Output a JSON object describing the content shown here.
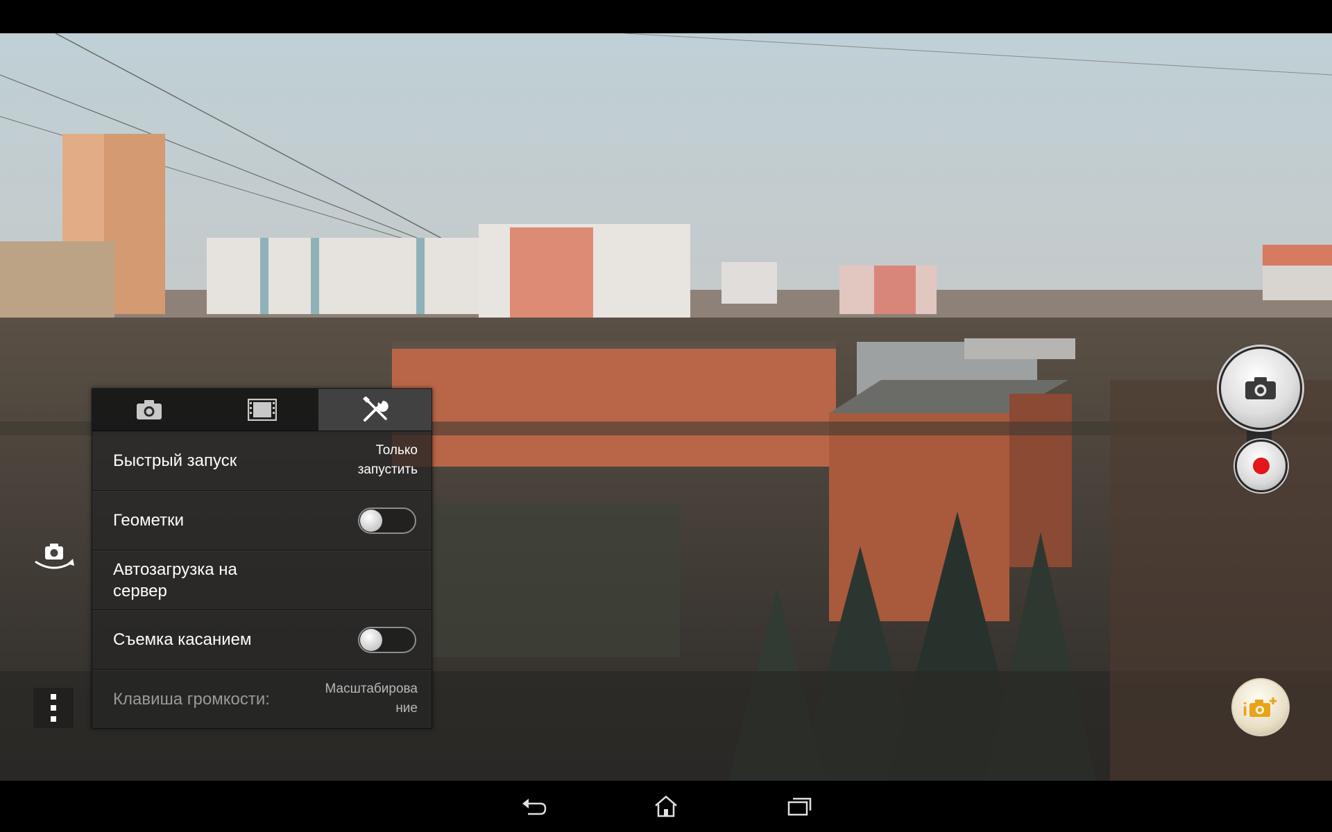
{
  "settings": {
    "tabs": [
      {
        "icon": "camera-icon"
      },
      {
        "icon": "film-icon"
      },
      {
        "icon": "tools-icon",
        "active": true
      }
    ],
    "rows": [
      {
        "label": "Быстрый запуск",
        "value_line1": "Только",
        "value_line2": "запустить"
      },
      {
        "label": "Геометки",
        "toggle": false
      },
      {
        "label_line1": "Автозагрузка на",
        "label_line2": "сервер"
      },
      {
        "label": "Съемка касанием",
        "toggle": false
      },
      {
        "label": "Клавиша громкости:",
        "value_line1": "Масштабирова",
        "value_line2": "ние"
      }
    ]
  },
  "controls": {
    "shutter_icon": "camera-icon",
    "record_color": "#e3161b",
    "mode_icon": "camera-plus-icon",
    "switch_camera_icon": "camera-switch-icon",
    "menu_icon": "more-vertical-icon"
  },
  "navigation": {
    "back_icon": "back-icon",
    "home_icon": "home-icon",
    "recents_icon": "recents-icon"
  }
}
